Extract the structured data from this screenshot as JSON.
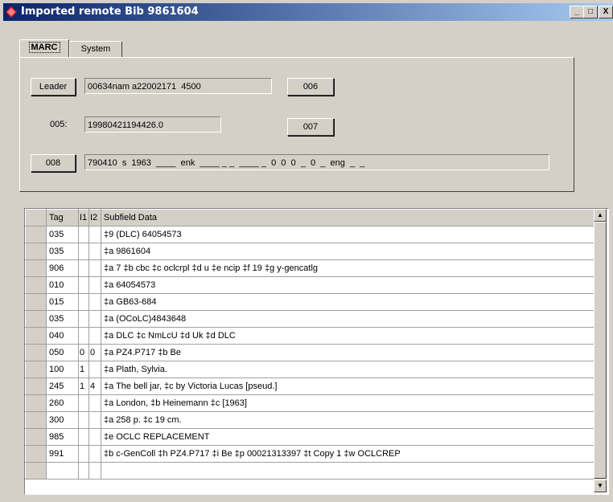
{
  "window": {
    "title": "Imported remote Bib 9861604",
    "minimize": "_",
    "maximize": "□",
    "close": "X"
  },
  "tabs": [
    {
      "label": "MARC"
    },
    {
      "label": "System"
    }
  ],
  "marc": {
    "leader_label": "Leader",
    "leader_value": "00634nam a22002171  4500",
    "f005_label": "005:",
    "f005_value": "19980421194426.0",
    "f006_label": "006",
    "f007_label": "007",
    "f008_label": "008",
    "f008_value": "790410  s  1963  ____  enk  ____ _ _  ____ _  0  0  0  _  0  _  eng  _  _"
  },
  "table": {
    "headers": [
      "",
      "Tag",
      "I1",
      "I2",
      "Subfield Data"
    ],
    "rows": [
      {
        "tag": "035",
        "i1": "",
        "i2": "",
        "data": "‡9 (DLC)   64054573"
      },
      {
        "tag": "035",
        "i1": "",
        "i2": "",
        "data": "‡a 9861604"
      },
      {
        "tag": "906",
        "i1": "",
        "i2": "",
        "data": "‡a 7 ‡b cbc ‡c oclcrpl ‡d u ‡e ncip ‡f 19 ‡g y-gencatlg"
      },
      {
        "tag": "010",
        "i1": "",
        "i2": "",
        "data": "‡a    64054573"
      },
      {
        "tag": "015",
        "i1": "",
        "i2": "",
        "data": "‡a GB63-684"
      },
      {
        "tag": "035",
        "i1": "",
        "i2": "",
        "data": "‡a (OCoLC)4843648"
      },
      {
        "tag": "040",
        "i1": "",
        "i2": "",
        "data": "‡a DLC ‡c NmLcU ‡d Uk ‡d DLC"
      },
      {
        "tag": "050",
        "i1": "0",
        "i2": "0",
        "data": "‡a PZ4.P717 ‡b Be"
      },
      {
        "tag": "100",
        "i1": "1",
        "i2": "",
        "data": "‡a Plath, Sylvia."
      },
      {
        "tag": "245",
        "i1": "1",
        "i2": "4",
        "data": "‡a The bell jar, ‡c by Victoria Lucas [pseud.]"
      },
      {
        "tag": "260",
        "i1": "",
        "i2": "",
        "data": "‡a London, ‡b Heinemann ‡c [1963]"
      },
      {
        "tag": "300",
        "i1": "",
        "i2": "",
        "data": "‡a 258 p. ‡c 19 cm."
      },
      {
        "tag": "985",
        "i1": "",
        "i2": "",
        "data": "‡e OCLC REPLACEMENT"
      },
      {
        "tag": "991",
        "i1": "",
        "i2": "",
        "data": "‡b c-GenColl ‡h PZ4.P717 ‡i Be ‡p 00021313397 ‡t Copy 1 ‡w OCLCREP"
      }
    ]
  },
  "icons": {
    "app": "diamond-app-icon",
    "scroll_up": "up-arrow-icon",
    "scroll_down": "down-arrow-icon"
  }
}
